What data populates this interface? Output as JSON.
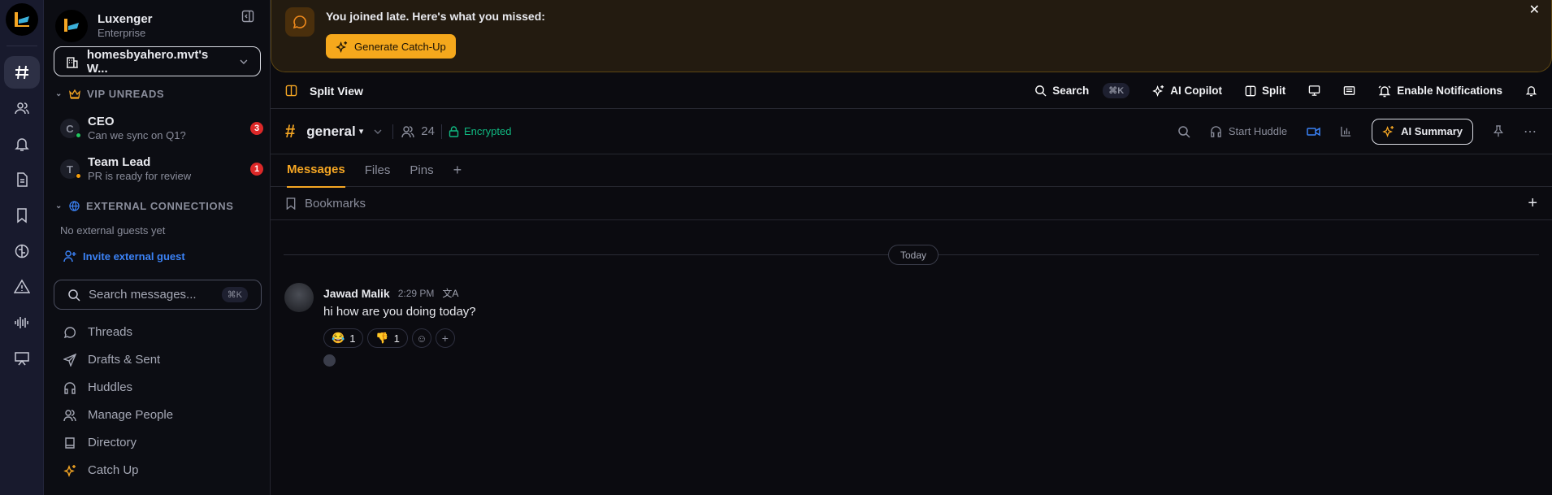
{
  "workspace": {
    "name": "Luxenger",
    "plan": "Enterprise",
    "selector": "homesbyahero.mvt's W..."
  },
  "rail": {
    "items": [
      "channels",
      "people",
      "notifications",
      "documents",
      "bookmarks",
      "ai-brain",
      "alerts",
      "audio",
      "presentations"
    ]
  },
  "vip": {
    "title": "VIP UNREADS",
    "items": [
      {
        "initial": "C",
        "name": "CEO",
        "preview": "Can we sync on Q1?",
        "count": "3",
        "status_color": "#22c55e"
      },
      {
        "initial": "T",
        "name": "Team Lead",
        "preview": "PR is ready for review",
        "count": "1",
        "status_color": "#f59e0b"
      }
    ]
  },
  "external": {
    "title": "EXTERNAL CONNECTIONS",
    "empty": "No external guests yet",
    "invite": "Invite external guest"
  },
  "sidebar_search": {
    "placeholder": "Search messages...",
    "shortcut": "⌘K"
  },
  "nav": [
    "Threads",
    "Drafts & Sent",
    "Huddles",
    "Manage People",
    "Directory",
    "Catch Up"
  ],
  "banner": {
    "title": "You joined late. Here's what you missed:",
    "button": "Generate Catch-Up"
  },
  "topbar": {
    "split_view": "Split View",
    "search": "Search",
    "search_shortcut": "⌘K",
    "copilot": "AI Copilot",
    "split": "Split",
    "notifications": "Enable Notifications"
  },
  "channel": {
    "name": "general",
    "members": "24",
    "encryption": "Encrypted",
    "huddle": "Start Huddle",
    "summary": "AI Summary"
  },
  "tabs": [
    "Messages",
    "Files",
    "Pins"
  ],
  "bookmarks": "Bookmarks",
  "date_divider": "Today",
  "message": {
    "author": "Jawad Malik",
    "time": "2:29 PM",
    "text": "hi how are you doing today?",
    "reactions": [
      {
        "emoji": "😂",
        "count": "1"
      },
      {
        "emoji": "👎",
        "count": "1"
      }
    ]
  },
  "colors": {
    "accent": "#f5a623",
    "link": "#3b82f6",
    "encrypted": "#10b981"
  }
}
